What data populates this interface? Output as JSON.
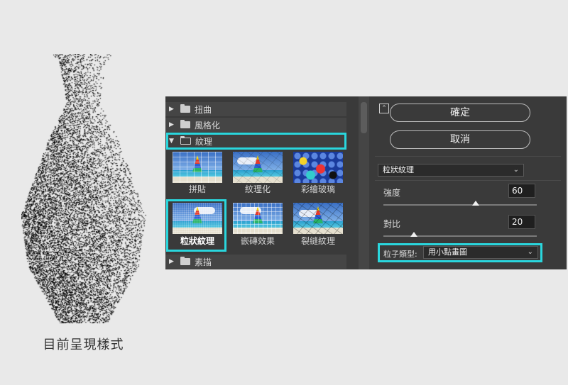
{
  "caption": "目前呈現樣式",
  "filter_gallery": {
    "folders": [
      {
        "label": "扭曲",
        "expanded": false
      },
      {
        "label": "風格化",
        "expanded": false
      },
      {
        "label": "紋理",
        "expanded": true
      },
      {
        "label": "素描",
        "expanded": false
      }
    ],
    "texture_filters": [
      {
        "label": "拼貼",
        "selected": false
      },
      {
        "label": "紋理化",
        "selected": false
      },
      {
        "label": "彩繪玻璃",
        "selected": false
      },
      {
        "label": "粒狀紋理",
        "selected": true
      },
      {
        "label": "嵌磚效果",
        "selected": false
      },
      {
        "label": "裂縫紋理",
        "selected": false
      }
    ]
  },
  "settings": {
    "ok_label": "確定",
    "cancel_label": "取消",
    "filter_select": "粒狀紋理",
    "intensity_label": "強度",
    "intensity_value": "60",
    "intensity_fraction": 0.6,
    "contrast_label": "對比",
    "contrast_value": "20",
    "contrast_fraction": 0.2,
    "grain_type_label": "粒子類型:",
    "grain_type_value": "用小點畫圖"
  },
  "colors": {
    "highlight": "#2ad6dd",
    "panel_bg": "#3a3a3a",
    "page_bg": "#e9e9e9"
  }
}
